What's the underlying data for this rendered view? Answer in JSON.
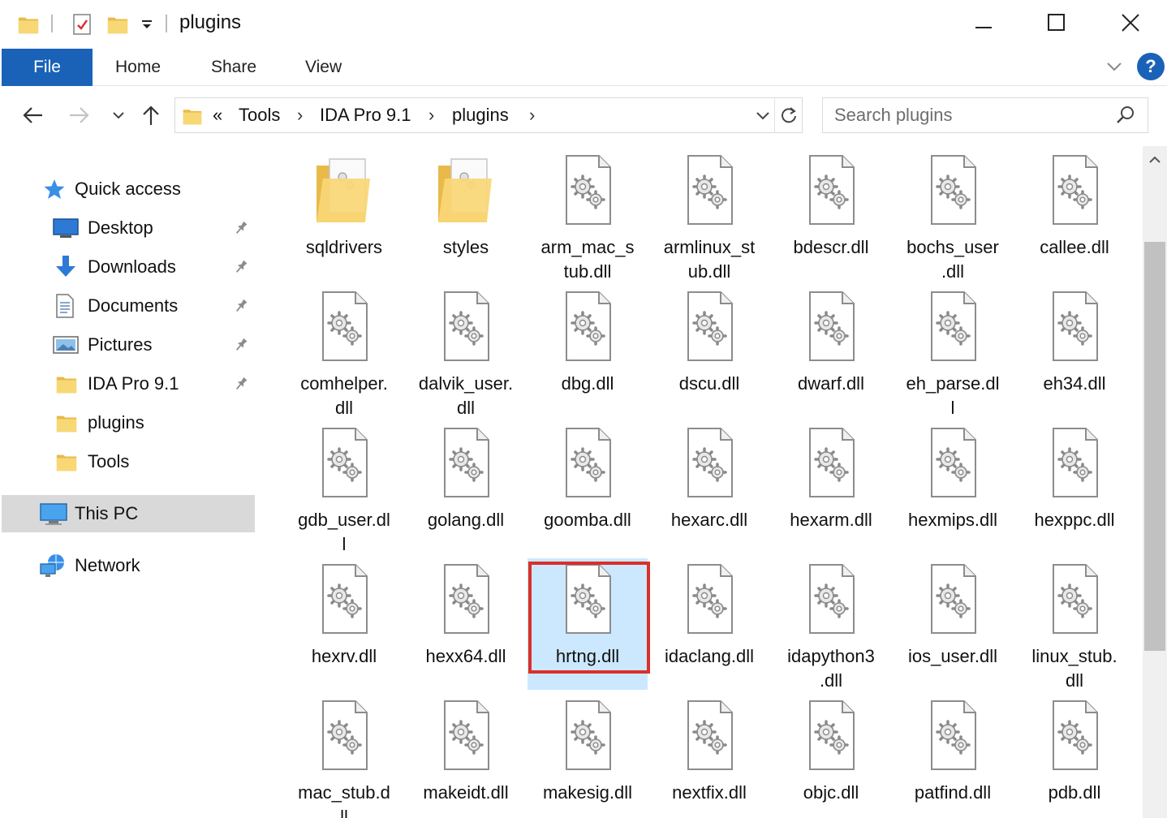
{
  "window": {
    "title": "plugins",
    "minimize": "—",
    "maximize": "☐",
    "close": "✕"
  },
  "ribbon": {
    "tabs": [
      "File",
      "Home",
      "Share",
      "View"
    ],
    "help": "?"
  },
  "address": {
    "overflow": "«",
    "segments": [
      "Tools",
      "IDA Pro 9.1",
      "plugins"
    ]
  },
  "search": {
    "placeholder": "Search plugins"
  },
  "sidebar": {
    "quick_access": "Quick access",
    "items": [
      {
        "label": "Desktop",
        "icon": "desktop-icon",
        "pinned": true
      },
      {
        "label": "Downloads",
        "icon": "downloads-icon",
        "pinned": true
      },
      {
        "label": "Documents",
        "icon": "documents-icon",
        "pinned": true
      },
      {
        "label": "Pictures",
        "icon": "pictures-icon",
        "pinned": true
      },
      {
        "label": "IDA Pro 9.1",
        "icon": "folder-icon",
        "pinned": true
      },
      {
        "label": "plugins",
        "icon": "folder-icon",
        "pinned": false
      },
      {
        "label": "Tools",
        "icon": "folder-icon",
        "pinned": false
      }
    ],
    "this_pc": "This PC",
    "network": "Network"
  },
  "files": [
    {
      "name": "sqldrivers",
      "display": "sqldrivers",
      "type": "folder"
    },
    {
      "name": "styles",
      "display": "styles",
      "type": "folder"
    },
    {
      "name": "arm_mac_stub.dll",
      "display": "arm_mac_s\ntub.dll",
      "type": "dll"
    },
    {
      "name": "armlinux_stub.dll",
      "display": "armlinux_st\nub.dll",
      "type": "dll"
    },
    {
      "name": "bdescr.dll",
      "display": "bdescr.dll",
      "type": "dll"
    },
    {
      "name": "bochs_user.dll",
      "display": "bochs_user\n.dll",
      "type": "dll"
    },
    {
      "name": "callee.dll",
      "display": "callee.dll",
      "type": "dll"
    },
    {
      "name": "comhelper.dll",
      "display": "comhelper.\ndll",
      "type": "dll"
    },
    {
      "name": "dalvik_user.dll",
      "display": "dalvik_user.\ndll",
      "type": "dll"
    },
    {
      "name": "dbg.dll",
      "display": "dbg.dll",
      "type": "dll"
    },
    {
      "name": "dscu.dll",
      "display": "dscu.dll",
      "type": "dll"
    },
    {
      "name": "dwarf.dll",
      "display": "dwarf.dll",
      "type": "dll"
    },
    {
      "name": "eh_parse.dll",
      "display": "eh_parse.dl\nl",
      "type": "dll"
    },
    {
      "name": "eh34.dll",
      "display": "eh34.dll",
      "type": "dll"
    },
    {
      "name": "gdb_user.dll",
      "display": "gdb_user.dl\nl",
      "type": "dll"
    },
    {
      "name": "golang.dll",
      "display": "golang.dll",
      "type": "dll"
    },
    {
      "name": "goomba.dll",
      "display": "goomba.dll",
      "type": "dll"
    },
    {
      "name": "hexarc.dll",
      "display": "hexarc.dll",
      "type": "dll"
    },
    {
      "name": "hexarm.dll",
      "display": "hexarm.dll",
      "type": "dll"
    },
    {
      "name": "hexmips.dll",
      "display": "hexmips.dll",
      "type": "dll"
    },
    {
      "name": "hexppc.dll",
      "display": "hexppc.dll",
      "type": "dll"
    },
    {
      "name": "hexrv.dll",
      "display": "hexrv.dll",
      "type": "dll"
    },
    {
      "name": "hexx64.dll",
      "display": "hexx64.dll",
      "type": "dll"
    },
    {
      "name": "hrtng.dll",
      "display": "hrtng.dll",
      "type": "dll",
      "selected": true
    },
    {
      "name": "idaclang.dll",
      "display": "idaclang.dll",
      "type": "dll"
    },
    {
      "name": "idapython3.dll",
      "display": "idapython3\n.dll",
      "type": "dll"
    },
    {
      "name": "ios_user.dll",
      "display": "ios_user.dll",
      "type": "dll"
    },
    {
      "name": "linux_stub.dll",
      "display": "linux_stub.\ndll",
      "type": "dll"
    },
    {
      "name": "mac_stub.dll",
      "display": "mac_stub.d\nll",
      "type": "dll"
    },
    {
      "name": "makeidt.dll",
      "display": "makeidt.dll",
      "type": "dll"
    },
    {
      "name": "makesig.dll",
      "display": "makesig.dll",
      "type": "dll"
    },
    {
      "name": "nextfix.dll",
      "display": "nextfix.dll",
      "type": "dll"
    },
    {
      "name": "objc.dll",
      "display": "objc.dll",
      "type": "dll"
    },
    {
      "name": "patfind.dll",
      "display": "patfind.dll",
      "type": "dll"
    },
    {
      "name": "pdb.dll",
      "display": "pdb.dll",
      "type": "dll"
    }
  ],
  "colors": {
    "accent": "#1a62b8",
    "selection": "#cce8ff",
    "highlight_outline": "#d9302c",
    "folder": "#f8d775"
  }
}
